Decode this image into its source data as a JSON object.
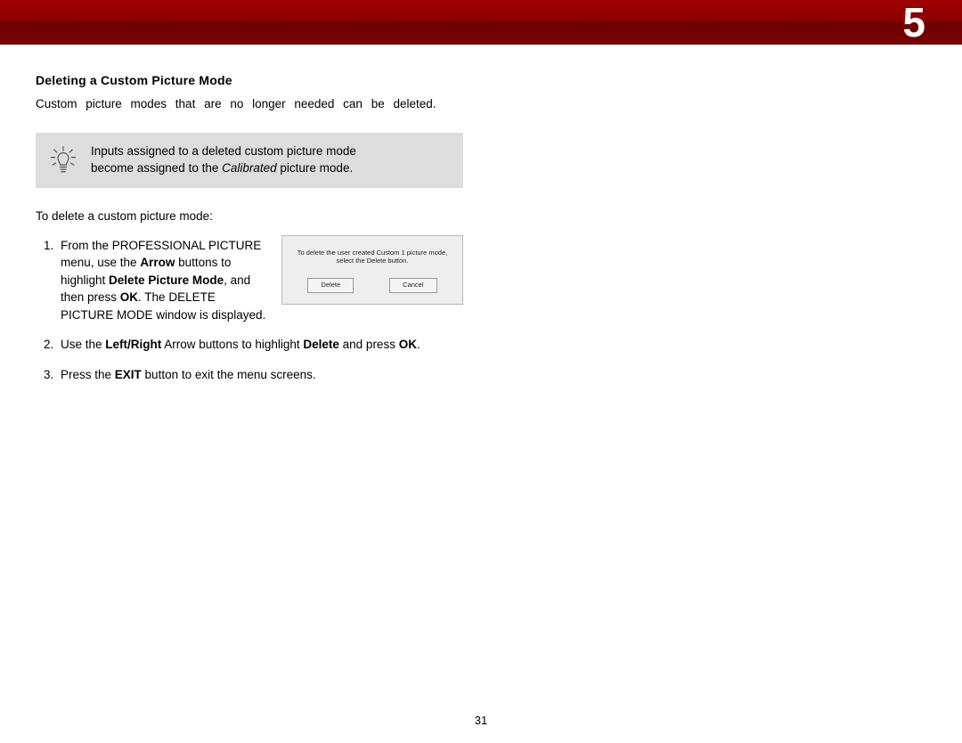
{
  "header": {
    "chapter": "5"
  },
  "section": {
    "title": "Deleting a Custom Picture Mode",
    "intro": "Custom picture modes that are no longer needed can be deleted."
  },
  "tip": {
    "line1": "Inputs assigned to a deleted custom picture mode",
    "line2_a": "become assigned to the ",
    "line2_italic": "Calibrated",
    "line2_b": " picture mode."
  },
  "lead": "To delete a custom picture mode:",
  "steps": {
    "s1_a": "From the PROFESSIONAL PICTURE menu, use the ",
    "s1_b_bold": "Arrow",
    "s1_c": " buttons to highlight ",
    "s1_d_bold": "Delete Picture Mode",
    "s1_e": ", and then press ",
    "s1_f_bold": "OK",
    "s1_g": ". The DELETE PICTURE MODE window is displayed.",
    "s2_a": "Use the ",
    "s2_b_bold": "Left/Right",
    "s2_c": " Arrow buttons to highlight ",
    "s2_d_bold": "Delete",
    "s2_e": " and press ",
    "s2_f_bold": "OK",
    "s2_g": ".",
    "s3_a": "Press the ",
    "s3_b_bold": "EXIT",
    "s3_c": " button to exit the menu screens."
  },
  "dialog": {
    "msg_l1": "To delete the user created Custom 1 picture mode,",
    "msg_l2": "select the Delete button.",
    "btn_delete": "Delete",
    "btn_cancel": "Cancel"
  },
  "page_number": "31"
}
